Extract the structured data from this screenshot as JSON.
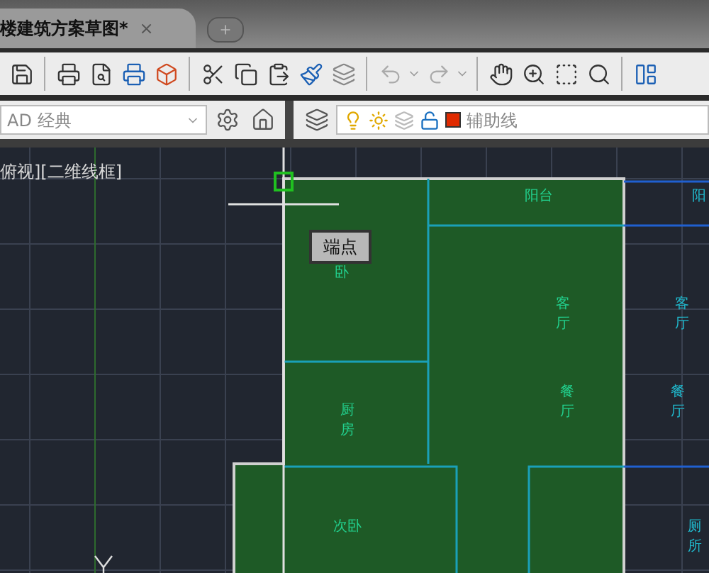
{
  "tab": {
    "title": "楼建筑方案草图*",
    "close": "×"
  },
  "workspace": {
    "value": "AD 经典"
  },
  "layer": {
    "name": "辅助线"
  },
  "viewport": {
    "label": "俯视][二维线框]"
  },
  "tooltip": {
    "text": "端点"
  },
  "rooms": [
    {
      "label": "阳台",
      "kind": "inline",
      "color": "#22d08e"
    },
    {
      "label": "卧",
      "kind": "inline",
      "color": "#22d08e"
    },
    {
      "label": "阳",
      "kind": "inline",
      "color": "#20b8cc"
    },
    {
      "label": "客厅",
      "kind": "stacked",
      "color": "#22d08e"
    },
    {
      "label": "客厅",
      "kind": "stacked",
      "color": "#20b8cc"
    },
    {
      "label": "厨房",
      "kind": "stacked",
      "color": "#22d08e"
    },
    {
      "label": "餐厅",
      "kind": "stacked",
      "color": "#22d08e"
    },
    {
      "label": "餐厅",
      "kind": "stacked",
      "color": "#20b8cc"
    },
    {
      "label": "次卧",
      "kind": "inline",
      "color": "#22d08e"
    },
    {
      "label": "厕所",
      "kind": "stacked",
      "color": "#20b8cc"
    }
  ]
}
